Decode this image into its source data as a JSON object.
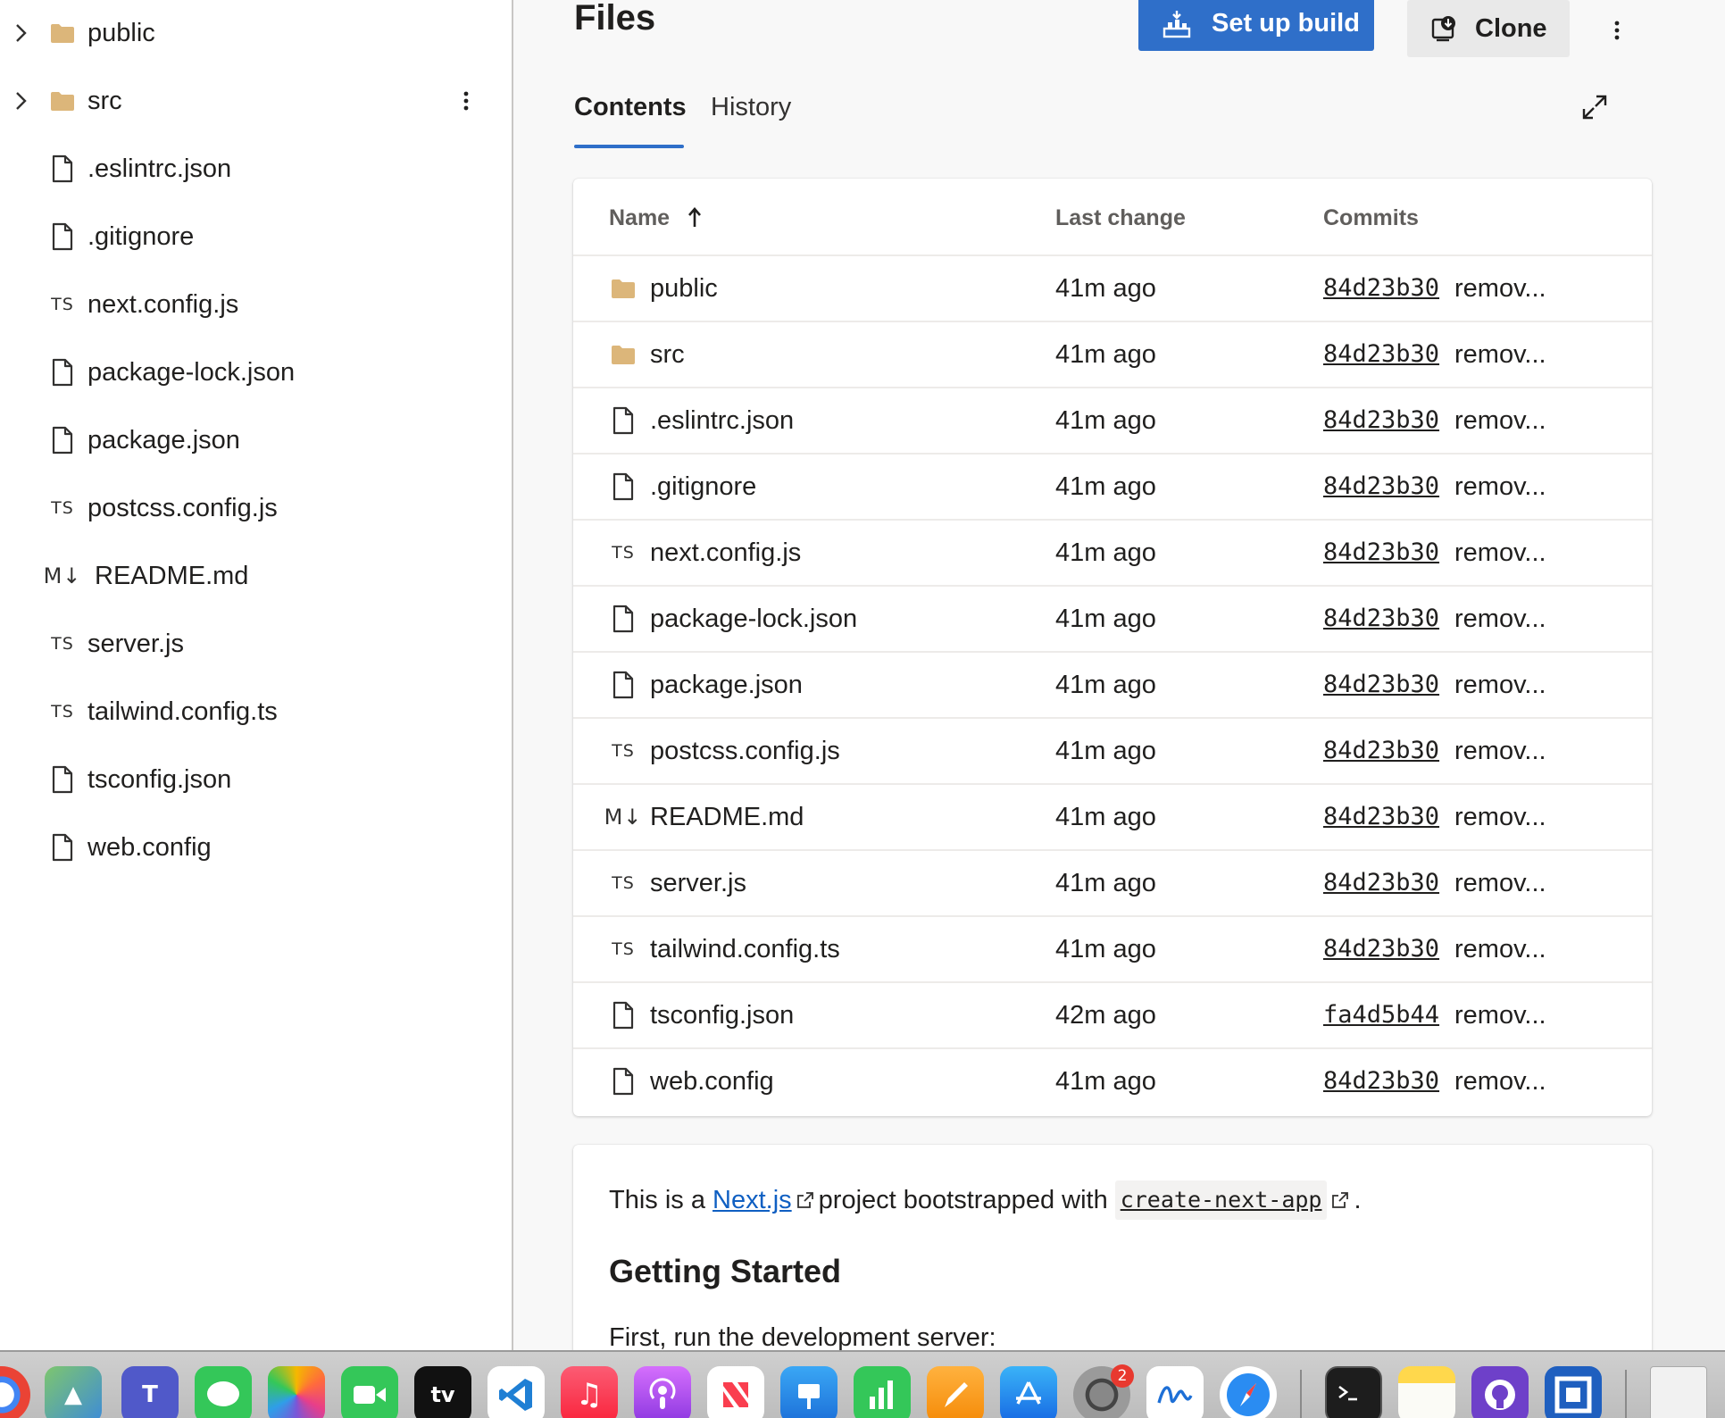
{
  "sidebar": {
    "items": [
      {
        "label": "public",
        "type": "folder",
        "expandable": true
      },
      {
        "label": "src",
        "type": "folder",
        "expandable": true
      },
      {
        "label": ".eslintrc.json",
        "type": "file"
      },
      {
        "label": ".gitignore",
        "type": "file"
      },
      {
        "label": "next.config.js",
        "type": "ts"
      },
      {
        "label": "package-lock.json",
        "type": "file"
      },
      {
        "label": "package.json",
        "type": "file"
      },
      {
        "label": "postcss.config.js",
        "type": "ts"
      },
      {
        "label": "README.md",
        "type": "md"
      },
      {
        "label": "server.js",
        "type": "ts"
      },
      {
        "label": "tailwind.config.ts",
        "type": "ts"
      },
      {
        "label": "tsconfig.json",
        "type": "file"
      },
      {
        "label": "web.config",
        "type": "file"
      }
    ]
  },
  "icons": {
    "ts_glyph": "TS",
    "md_glyph": "M↓"
  },
  "header": {
    "title": "Files",
    "build_label": "Set up build",
    "clone_label": "Clone"
  },
  "tabs": {
    "contents": "Contents",
    "history": "History"
  },
  "table": {
    "columns": {
      "name": "Name",
      "last_change": "Last change",
      "commits": "Commits"
    },
    "rows": [
      {
        "name": "public",
        "type": "folder",
        "last_change": "41m ago",
        "commit": "84d23b30",
        "message": "remov..."
      },
      {
        "name": "src",
        "type": "folder",
        "last_change": "41m ago",
        "commit": "84d23b30",
        "message": "remov..."
      },
      {
        "name": ".eslintrc.json",
        "type": "file",
        "last_change": "41m ago",
        "commit": "84d23b30",
        "message": "remov..."
      },
      {
        "name": ".gitignore",
        "type": "file",
        "last_change": "41m ago",
        "commit": "84d23b30",
        "message": "remov..."
      },
      {
        "name": "next.config.js",
        "type": "ts",
        "last_change": "41m ago",
        "commit": "84d23b30",
        "message": "remov..."
      },
      {
        "name": "package-lock.json",
        "type": "file",
        "last_change": "41m ago",
        "commit": "84d23b30",
        "message": "remov..."
      },
      {
        "name": "package.json",
        "type": "file",
        "last_change": "41m ago",
        "commit": "84d23b30",
        "message": "remov..."
      },
      {
        "name": "postcss.config.js",
        "type": "ts",
        "last_change": "41m ago",
        "commit": "84d23b30",
        "message": "remov..."
      },
      {
        "name": "README.md",
        "type": "md",
        "last_change": "41m ago",
        "commit": "84d23b30",
        "message": "remov..."
      },
      {
        "name": "server.js",
        "type": "ts",
        "last_change": "41m ago",
        "commit": "84d23b30",
        "message": "remov..."
      },
      {
        "name": "tailwind.config.ts",
        "type": "ts",
        "last_change": "41m ago",
        "commit": "84d23b30",
        "message": "remov..."
      },
      {
        "name": "tsconfig.json",
        "type": "file",
        "last_change": "42m ago",
        "commit": "fa4d5b44",
        "message": "remov..."
      },
      {
        "name": "web.config",
        "type": "file",
        "last_change": "41m ago",
        "commit": "84d23b30",
        "message": "remov..."
      }
    ]
  },
  "readme": {
    "intro_prefix": "This is a ",
    "nextjs_link": "Next.js",
    "intro_middle": "project bootstrapped with",
    "cna_code": "create-next-app",
    "intro_suffix": ".",
    "heading": "Getting Started",
    "paragraph": "First, run the development server:"
  },
  "dock": {
    "settings_badge": "2",
    "tv_label": "tv"
  },
  "colors": {
    "accent": "#2f6fc9",
    "folder": "#dcb67a",
    "link": "#0f5fc2"
  }
}
